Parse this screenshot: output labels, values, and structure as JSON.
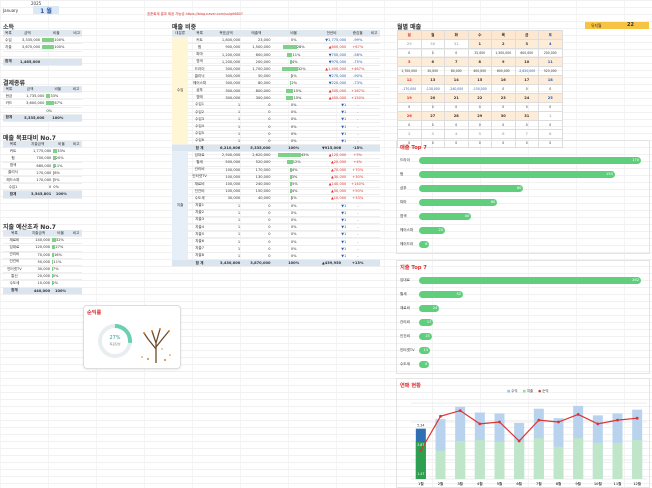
{
  "header": {
    "year": "2025",
    "month_label": "January",
    "month_value": "1",
    "month_unit": "월",
    "notice": "표준회계 결과 제공 가능성  https://blog.naver.com/sulgit6807"
  },
  "income": {
    "title": "소득",
    "cols": [
      "목록",
      "금액",
      "비율",
      "비고"
    ],
    "rows": [
      [
        "수입",
        "3,335,000",
        "100%",
        ""
      ],
      [
        "지출",
        "3,670,000",
        "100%",
        ""
      ],
      [
        "",
        "",
        "",
        ""
      ]
    ],
    "total": [
      "합계",
      "1,465,000",
      "",
      ""
    ]
  },
  "loans": {
    "title": "결제종류",
    "cols": [
      "목록",
      "금액",
      "비율",
      "비고"
    ],
    "rows": [
      [
        "현금",
        "1,735,000",
        "33%",
        ""
      ],
      [
        "카드",
        "3,600,000",
        "67%",
        ""
      ],
      [
        "",
        "",
        "0%",
        ""
      ]
    ],
    "total": [
      "합계",
      "5,335,000",
      "100%",
      ""
    ]
  },
  "sales_top": {
    "title": "매출 목표대비 No.7",
    "cols": [
      "목록",
      "지출금액",
      "비율",
      "비고"
    ],
    "rows": [
      [
        "커트",
        "1,775,000",
        "33%",
        ""
      ],
      [
        "펌",
        "700,000",
        "20%",
        ""
      ],
      [
        "염색",
        "680,000",
        "11%",
        ""
      ],
      [
        "클리닉",
        "270,000",
        "8%",
        ""
      ],
      [
        "헤드스파",
        "170,000",
        "5%",
        ""
      ],
      [
        "수입1",
        "0",
        "0%",
        ""
      ]
    ],
    "total": [
      "합계",
      "3,545,801",
      "100%",
      ""
    ]
  },
  "expense_top": {
    "title": "지출 예산초과 No.7",
    "cols": [
      "목록",
      "지출금액",
      "비율",
      "비고"
    ],
    "rows": [
      [
        "재료비",
        "140,000",
        "32%",
        ""
      ],
      [
        "임대료",
        "120,000",
        "27%",
        ""
      ],
      [
        "관리비",
        "70,000",
        "16%",
        ""
      ],
      [
        "인건비",
        "50,000",
        "11%",
        ""
      ],
      [
        "인터넷TV",
        "30,000",
        "7%",
        ""
      ],
      [
        "통신",
        "20,000",
        "5%",
        ""
      ],
      [
        "수도세",
        "10,000",
        "2%",
        ""
      ]
    ],
    "total": [
      "합계",
      "440,000",
      "100%",
      ""
    ]
  },
  "profit_card": {
    "title": "순익률",
    "percent": "27%",
    "sub": "목표달성"
  },
  "summary": {
    "title": "매출 비중",
    "cols": [
      "대분류",
      "목록",
      "목표금액",
      "매출액",
      "비율",
      "전년비",
      "증감율",
      "비고"
    ],
    "income_group": "수입",
    "expense_group": "지출",
    "income_rows": [
      [
        "커트",
        "1,800,000",
        "23,000",
        "0%",
        "▼1,775,000",
        "-99%"
      ],
      [
        "펌",
        "900,000",
        "1,500,000",
        "28%",
        "▲600,000",
        "+67%"
      ],
      [
        "파마",
        "1,200,000",
        "600,000",
        "11%",
        "▼700,000",
        "-58%"
      ],
      [
        "염색",
        "1,200,000",
        "200,000",
        "4%",
        "▼970,000",
        "-75%"
      ],
      [
        "드라이",
        "300,000",
        "1,700,000",
        "32%",
        "▲1,400,000",
        "+467%"
      ],
      [
        "클리닉",
        "300,000",
        "50,000",
        "1%",
        "▼270,000",
        "-90%"
      ],
      [
        "헤어스파",
        "300,000",
        "80,000",
        "2%",
        "▼220,000",
        "-73%"
      ],
      [
        "샴푸",
        "300,000",
        "800,000",
        "15%",
        "▲500,000",
        "+167%"
      ],
      [
        "염매",
        "300,000",
        "300,000",
        "15%",
        "▲450,000",
        "+150%"
      ],
      [
        "수입1",
        "1",
        "0",
        "0%",
        "▼1",
        "-"
      ],
      [
        "수입2",
        "1",
        "0",
        "0%",
        "▼1",
        "-"
      ],
      [
        "수입3",
        "1",
        "0",
        "0%",
        "▼1",
        "-"
      ],
      [
        "수입4",
        "1",
        "0",
        "0%",
        "▼1",
        "-"
      ],
      [
        "수입5",
        "1",
        "0",
        "0%",
        "▼1",
        "-"
      ],
      [
        "수입6",
        "1",
        "0",
        "0%",
        "▼1",
        "-"
      ]
    ],
    "income_total": [
      "합 계",
      "6,210,006",
      "5,335,000",
      "100%",
      "▼915,006",
      "-15%"
    ],
    "expense_rows": [
      [
        "임대료",
        "2,500,000",
        "2,620,000",
        "45%",
        "▲120,000",
        "+5%"
      ],
      [
        "월세",
        "500,000",
        "520,000",
        "12%",
        "▲20,000",
        "+4%"
      ],
      [
        "관리비",
        "100,000",
        "170,000",
        "4%",
        "▲70,000",
        "+70%"
      ],
      [
        "인터넷TV",
        "100,000",
        "130,000",
        "3%",
        "▲30,000",
        "+30%"
      ],
      [
        "재료비",
        "100,000",
        "240,000",
        "5%",
        "▲140,000",
        "+140%"
      ],
      [
        "인건비",
        "100,000",
        "150,000",
        "4%",
        "▲50,000",
        "+50%"
      ],
      [
        "수도세",
        "30,000",
        "40,000",
        "1%",
        "▲10,000",
        "+33%"
      ],
      [
        "지출1",
        "1",
        "0",
        "0%",
        "▼1",
        "-"
      ],
      [
        "지출2",
        "1",
        "0",
        "0%",
        "▼1",
        "-"
      ],
      [
        "지출3",
        "1",
        "0",
        "0%",
        "▼1",
        "-"
      ],
      [
        "지출4",
        "1",
        "0",
        "0%",
        "▼1",
        "-"
      ],
      [
        "지출5",
        "1",
        "0",
        "0%",
        "▼1",
        "-"
      ],
      [
        "지출6",
        "1",
        "0",
        "0%",
        "▼1",
        "-"
      ],
      [
        "지출7",
        "1",
        "0",
        "0%",
        "▼1",
        "-"
      ],
      [
        "지출8",
        "1",
        "0",
        "0%",
        "▼1",
        "-"
      ]
    ],
    "expense_total": [
      "합 계",
      "3,430,000",
      "3,870,000",
      "100%",
      "▲439,950",
      "+13%"
    ]
  },
  "calendar": {
    "title": "월별 매출",
    "total_label": "유지월",
    "total_value": "22",
    "days": [
      "일",
      "월",
      "화",
      "수",
      "목",
      "금",
      "토"
    ],
    "weeks": [
      {
        "dates": [
          "29",
          "30",
          "31",
          "1",
          "2",
          "3",
          "4"
        ],
        "values": [
          "0",
          "0",
          "0",
          "25,000",
          "1,500,000",
          "600,000",
          "200,000"
        ]
      },
      {
        "dates": [
          "5",
          "6",
          "7",
          "8",
          "9",
          "10",
          "11"
        ],
        "values": [
          "1,700,000",
          "20,000",
          "80,000",
          "400,000",
          "600,000",
          "-2,620,000",
          "520,000"
        ]
      },
      {
        "dates": [
          "12",
          "13",
          "14",
          "15",
          "16",
          "17",
          "18"
        ],
        "values": [
          "-170,000",
          "-130,000",
          "-240,000",
          "-150,000",
          "0",
          "0",
          "0"
        ]
      },
      {
        "dates": [
          "19",
          "20",
          "21",
          "22",
          "23",
          "24",
          "25"
        ],
        "values": [
          "0",
          "0",
          "0",
          "0",
          "0",
          "0",
          "0"
        ]
      },
      {
        "dates": [
          "26",
          "27",
          "28",
          "29",
          "30",
          "31",
          "1"
        ],
        "values": [
          "0",
          "0",
          "0",
          "0",
          "0",
          "0",
          "0"
        ]
      },
      {
        "dates": [
          "2",
          "3",
          "4",
          "5",
          "6",
          "7",
          "8"
        ],
        "values": [
          "0",
          "0",
          "0",
          "0",
          "0",
          "0",
          "0"
        ]
      }
    ]
  },
  "sales_top7": {
    "title": "매출 Top 7",
    "items": [
      [
        "드라이",
        170
      ],
      [
        "펌",
        150
      ],
      [
        "샴푸",
        80
      ],
      [
        "파마",
        60
      ],
      [
        "염색",
        40
      ],
      [
        "헤어스파",
        20
      ],
      [
        "헤어드라",
        8
      ]
    ]
  },
  "expense_top7": {
    "title": "지출 Top 7",
    "items": [
      [
        "임대료",
        262
      ],
      [
        "월세",
        52
      ],
      [
        "재료비",
        24
      ],
      [
        "관리비",
        17
      ],
      [
        "인건비",
        15
      ],
      [
        "인터넷TV",
        13
      ],
      [
        "수도세",
        4
      ]
    ]
  },
  "trend": {
    "title": "연매 현황",
    "legend": [
      "수익",
      "지출",
      "순익"
    ],
    "months": [
      "1월",
      "2월",
      "3월",
      "4월",
      "5월",
      "6월",
      "7월",
      "8월",
      "9월",
      "10월",
      "11월",
      "12월"
    ],
    "first_label": "5.34",
    "first_label2": "3.87",
    "first_label3": "1.47",
    "bar_income": [
      5.3,
      6.3,
      7.6,
      7.0,
      6.9,
      5.9,
      7.4,
      6.4,
      7.7,
      6.7,
      6.9,
      7.3
    ],
    "bar_expense": [
      3.9,
      3.0,
      4.0,
      4.1,
      3.9,
      3.9,
      4.3,
      3.4,
      4.3,
      3.8,
      3.8,
      4.1
    ],
    "line_profit": [
      1.5,
      3.3,
      3.6,
      2.9,
      3.0,
      2.0,
      3.1,
      3.0,
      3.4,
      2.9,
      3.1,
      3.2
    ]
  },
  "colors": {
    "accent": "#5fcf7d",
    "header": "#dfe7f0",
    "red": "#d33333",
    "yellow": "#f6c342"
  }
}
